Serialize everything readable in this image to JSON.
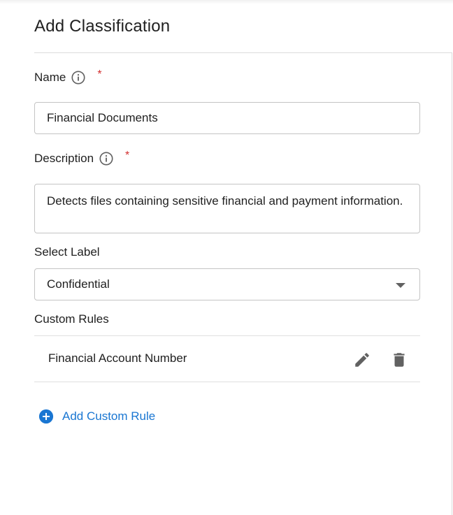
{
  "dialog": {
    "title": "Add Classification"
  },
  "name_field": {
    "label": "Name",
    "required_mark": "*",
    "value": "Financial Documents"
  },
  "description_field": {
    "label": "Description",
    "required_mark": "*",
    "value": "Detects files containing sensitive financial and payment information."
  },
  "label_field": {
    "label": "Select Label",
    "selected": "Confidential"
  },
  "custom_rules": {
    "label": "Custom Rules",
    "items": [
      {
        "name": "Financial Account Number",
        "edit_icon": "pencil-icon",
        "delete_icon": "trash-icon"
      }
    ],
    "add_label": "Add Custom Rule"
  },
  "colors": {
    "accent": "#1976d2",
    "required": "#d32f2f",
    "icon": "#616161"
  }
}
